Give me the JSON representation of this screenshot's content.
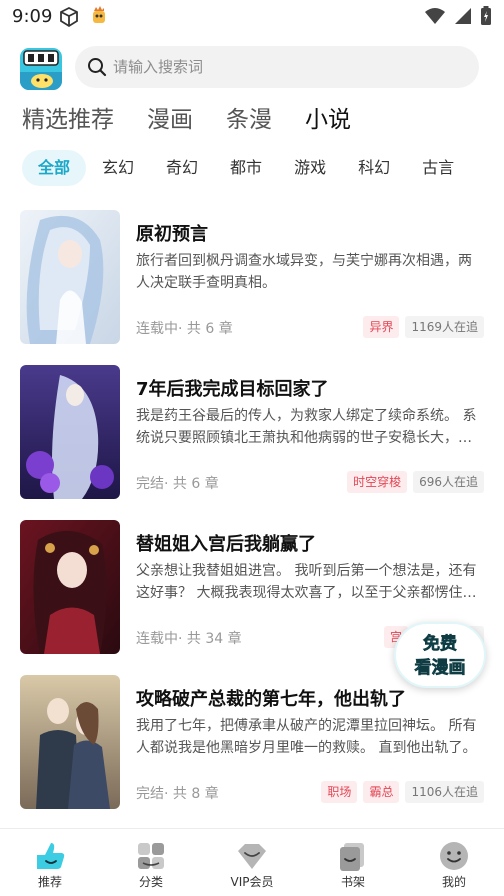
{
  "status_bar": {
    "time": "9:09"
  },
  "search": {
    "placeholder": "请输入搜索词"
  },
  "main_tabs": [
    {
      "label": "精选推荐",
      "active": false
    },
    {
      "label": "漫画",
      "active": false
    },
    {
      "label": "条漫",
      "active": false
    },
    {
      "label": "小说",
      "active": true
    }
  ],
  "categories": [
    {
      "label": "全部",
      "active": true
    },
    {
      "label": "玄幻"
    },
    {
      "label": "奇幻"
    },
    {
      "label": "都市"
    },
    {
      "label": "游戏"
    },
    {
      "label": "科幻"
    },
    {
      "label": "古言"
    }
  ],
  "novels": [
    {
      "title": "原初预言",
      "description": "旅行者回到枫丹调查水域异变，与芙宁娜再次相遇，两人决定联手查明真相。",
      "meta": "连载中· 共 6 章",
      "tags": [
        "异界"
      ],
      "followers": "1169人在追"
    },
    {
      "title": "7年后我完成目标回家了",
      "description": "我是药王谷最后的传人，为救家人绑定了续命系统。 系统说只要照顾镇北王萧执和他病弱的世子安稳长大，我就能回家。",
      "meta": "完结· 共 6 章",
      "tags": [
        "时空穿梭"
      ],
      "followers": "696人在追"
    },
    {
      "title": "替姐姐入宫后我躺赢了",
      "description": "父亲想让我替姐姐进宫。 我听到后第一个想法是，还有这好事？ 大概我表现得太欢喜了，以至于父亲都愣住了。",
      "meta": "连载中· 共 34 章",
      "tags": [
        "宫"
      ],
      "followers": ""
    },
    {
      "title": "攻略破产总裁的第七年，他出轨了",
      "description": "我用了七年，把傅承聿从破产的泥潭里拉回神坛。 所有人都说我是他黑暗岁月里唯一的救赎。 直到他出轨了。",
      "meta": "完结· 共 8 章",
      "tags": [
        "职场",
        "霸总"
      ],
      "followers": "1106人在追"
    }
  ],
  "float_badge": {
    "line1": "免费",
    "line2": "看漫画"
  },
  "bottom_nav": [
    {
      "label": "推荐",
      "icon": "recommend-icon",
      "active": true
    },
    {
      "label": "分类",
      "icon": "category-icon"
    },
    {
      "label": "VIP会员",
      "icon": "vip-icon"
    },
    {
      "label": "书架",
      "icon": "bookshelf-icon"
    },
    {
      "label": "我的",
      "icon": "profile-icon"
    }
  ],
  "colors": {
    "accent": "#1ca8c8",
    "tab_highlight": "#b7ecf4",
    "tag_red": "#e24756"
  }
}
